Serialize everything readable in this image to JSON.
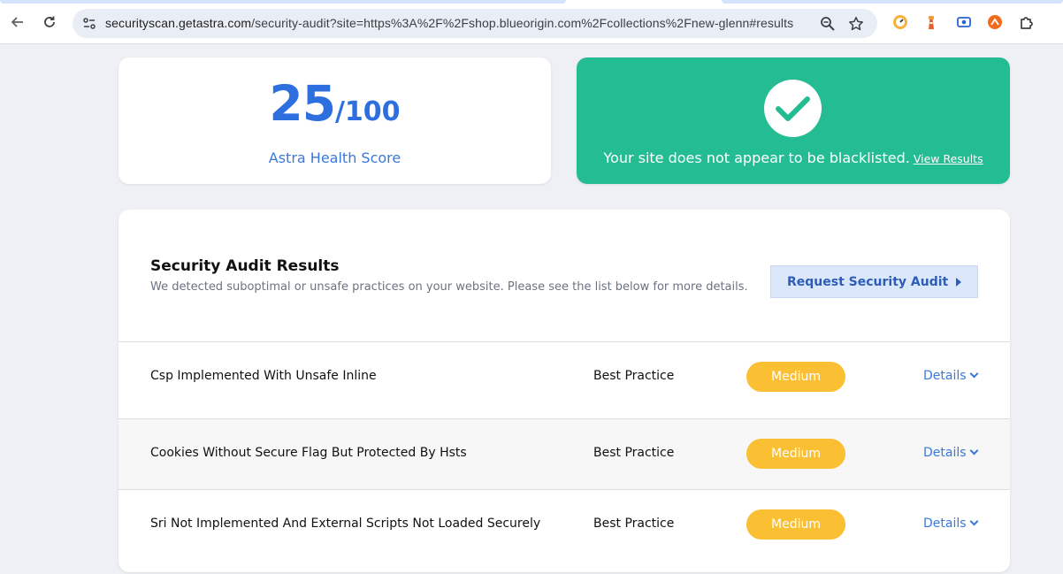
{
  "browser": {
    "url_host": "securityscan.getastra.com",
    "url_path": "/security-audit?site=https%3A%2F%2Fshop.blueorigin.com%2Fcollections%2Fnew-glenn#results",
    "icons": [
      "back-arrow-icon",
      "reload-icon",
      "site-info-icon",
      "zoom-icon",
      "star-icon",
      "extension-icons",
      "puzzle-icon"
    ]
  },
  "score": {
    "value": "25",
    "max": "/100",
    "label": "Astra Health Score"
  },
  "blacklist": {
    "message": "Your site does not appear to be blacklisted.",
    "link": "View Results"
  },
  "audit": {
    "title": "Security Audit Results",
    "subtitle": "We detected suboptimal or unsafe practices on your website. Please see the list below for more details.",
    "button": "Request Security Audit",
    "rows": [
      {
        "name": "Csp Implemented With Unsafe Inline",
        "category": "Best Practice",
        "severity": "Medium",
        "details": "Details"
      },
      {
        "name": "Cookies Without Secure Flag But Protected By Hsts",
        "category": "Best Practice",
        "severity": "Medium",
        "details": "Details"
      },
      {
        "name": "Sri Not Implemented And External Scripts Not Loaded Securely",
        "category": "Best Practice",
        "severity": "Medium",
        "details": "Details"
      }
    ]
  },
  "colors": {
    "accent_blue": "#2d6fdf",
    "success_green": "#24bc92",
    "medium_badge": "#fbbf33"
  }
}
